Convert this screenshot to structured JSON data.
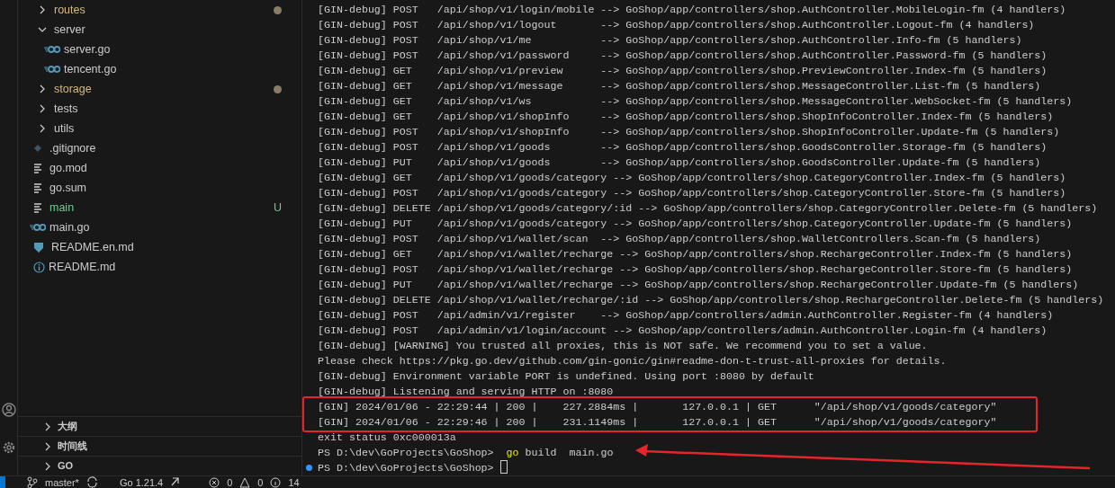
{
  "activity_bar": {
    "icons": [
      {
        "kind": "account"
      },
      {
        "kind": "settings"
      }
    ]
  },
  "explorer": {
    "items": [
      {
        "label": "routes",
        "kind": "folder",
        "expanded": false,
        "modified": true
      },
      {
        "label": "server",
        "kind": "folder",
        "expanded": true,
        "children": [
          {
            "label": "server.go",
            "kind": "go"
          },
          {
            "label": "tencent.go",
            "kind": "go"
          }
        ]
      },
      {
        "label": "storage",
        "kind": "folder",
        "expanded": false,
        "modified": true
      },
      {
        "label": "tests",
        "kind": "folder",
        "expanded": false
      },
      {
        "label": "utils",
        "kind": "folder",
        "expanded": false
      },
      {
        "label": ".gitignore",
        "kind": "git"
      },
      {
        "label": "go.mod",
        "kind": "text"
      },
      {
        "label": "go.sum",
        "kind": "text"
      },
      {
        "label": "main",
        "kind": "text",
        "untracked": true,
        "badge": "U"
      },
      {
        "label": "main.go",
        "kind": "go"
      },
      {
        "label": "README.en.md",
        "kind": "markdown"
      },
      {
        "label": "README.md",
        "kind": "info"
      }
    ]
  },
  "panels": [
    {
      "label": "大纲",
      "expanded": false
    },
    {
      "label": "时间线",
      "expanded": false
    },
    {
      "label": "GO",
      "expanded": false
    }
  ],
  "terminal": {
    "lines": [
      {
        "kind": "output",
        "text": "[GIN-debug] POST   /api/shop/v1/login/mobile --> GoShop/app/controllers/shop.AuthController.MobileLogin-fm (4 handlers)"
      },
      {
        "kind": "output",
        "text": "[GIN-debug] POST   /api/shop/v1/logout       --> GoShop/app/controllers/shop.AuthController.Logout-fm (4 handlers)"
      },
      {
        "kind": "output",
        "text": "[GIN-debug] POST   /api/shop/v1/me           --> GoShop/app/controllers/shop.AuthController.Info-fm (5 handlers)"
      },
      {
        "kind": "output",
        "text": "[GIN-debug] POST   /api/shop/v1/password     --> GoShop/app/controllers/shop.AuthController.Password-fm (5 handlers)"
      },
      {
        "kind": "output",
        "text": "[GIN-debug] GET    /api/shop/v1/preview      --> GoShop/app/controllers/shop.PreviewController.Index-fm (5 handlers)"
      },
      {
        "kind": "output",
        "text": "[GIN-debug] GET    /api/shop/v1/message      --> GoShop/app/controllers/shop.MessageController.List-fm (5 handlers)"
      },
      {
        "kind": "output",
        "text": "[GIN-debug] GET    /api/shop/v1/ws           --> GoShop/app/controllers/shop.MessageController.WebSocket-fm (5 handlers)"
      },
      {
        "kind": "output",
        "text": "[GIN-debug] GET    /api/shop/v1/shopInfo     --> GoShop/app/controllers/shop.ShopInfoController.Index-fm (5 handlers)"
      },
      {
        "kind": "output",
        "text": "[GIN-debug] POST   /api/shop/v1/shopInfo     --> GoShop/app/controllers/shop.ShopInfoController.Update-fm (5 handlers)"
      },
      {
        "kind": "output",
        "text": "[GIN-debug] POST   /api/shop/v1/goods        --> GoShop/app/controllers/shop.GoodsController.Storage-fm (5 handlers)"
      },
      {
        "kind": "output",
        "text": "[GIN-debug] PUT    /api/shop/v1/goods        --> GoShop/app/controllers/shop.GoodsController.Update-fm (5 handlers)"
      },
      {
        "kind": "output",
        "text": "[GIN-debug] GET    /api/shop/v1/goods/category --> GoShop/app/controllers/shop.CategoryController.Index-fm (5 handlers)"
      },
      {
        "kind": "output",
        "text": "[GIN-debug] POST   /api/shop/v1/goods/category --> GoShop/app/controllers/shop.CategoryController.Store-fm (5 handlers)"
      },
      {
        "kind": "output",
        "text": "[GIN-debug] DELETE /api/shop/v1/goods/category/:id --> GoShop/app/controllers/shop.CategoryController.Delete-fm (5 handlers)"
      },
      {
        "kind": "output",
        "text": "[GIN-debug] PUT    /api/shop/v1/goods/category --> GoShop/app/controllers/shop.CategoryController.Update-fm (5 handlers)"
      },
      {
        "kind": "output",
        "text": "[GIN-debug] POST   /api/shop/v1/wallet/scan  --> GoShop/app/controllers/shop.WalletControllers.Scan-fm (5 handlers)"
      },
      {
        "kind": "output",
        "text": "[GIN-debug] GET    /api/shop/v1/wallet/recharge --> GoShop/app/controllers/shop.RechargeController.Index-fm (5 handlers)"
      },
      {
        "kind": "output",
        "text": "[GIN-debug] POST   /api/shop/v1/wallet/recharge --> GoShop/app/controllers/shop.RechargeController.Store-fm (5 handlers)"
      },
      {
        "kind": "output",
        "text": "[GIN-debug] PUT    /api/shop/v1/wallet/recharge --> GoShop/app/controllers/shop.RechargeController.Update-fm (5 handlers)"
      },
      {
        "kind": "output",
        "text": "[GIN-debug] DELETE /api/shop/v1/wallet/recharge/:id --> GoShop/app/controllers/shop.RechargeController.Delete-fm (5 handlers)"
      },
      {
        "kind": "output",
        "text": "[GIN-debug] POST   /api/admin/v1/register    --> GoShop/app/controllers/admin.AuthController.Register-fm (4 handlers)"
      },
      {
        "kind": "output",
        "text": "[GIN-debug] POST   /api/admin/v1/login/account --> GoShop/app/controllers/admin.AuthController.Login-fm (4 handlers)"
      },
      {
        "kind": "output",
        "text": "[GIN-debug] [WARNING] You trusted all proxies, this is NOT safe. We recommend you to set a value."
      },
      {
        "kind": "output",
        "text": "Please check https://pkg.go.dev/github.com/gin-gonic/gin#readme-don-t-trust-all-proxies for details."
      },
      {
        "kind": "output",
        "text": "[GIN-debug] Environment variable PORT is undefined. Using port :8080 by default"
      },
      {
        "kind": "output",
        "text": "[GIN-debug] Listening and serving HTTP on :8080"
      },
      {
        "kind": "output",
        "highlighted": true,
        "text": "[GIN] 2024/01/06 - 22:29:44 | 200 |    227.2884ms |       127.0.0.1 | GET      \"/api/shop/v1/goods/category\""
      },
      {
        "kind": "output",
        "highlighted": true,
        "text": "[GIN] 2024/01/06 - 22:29:46 | 200 |    231.1149ms |       127.0.0.1 | GET      \"/api/shop/v1/goods/category\""
      },
      {
        "kind": "output",
        "text": "exit status 0xc000013a"
      },
      {
        "kind": "command",
        "prompt": "PS D:\\dev\\GoProjects\\GoShop>",
        "program": "go",
        "args": "build  main.go",
        "pointed": true
      },
      {
        "kind": "prompt",
        "prompt": "PS D:\\dev\\GoProjects\\GoShop>"
      }
    ]
  },
  "status_bar": {
    "branch": "master*",
    "go_version": "Go 1.21.4",
    "errors": "0",
    "warnings": "0",
    "infos": "14"
  }
}
